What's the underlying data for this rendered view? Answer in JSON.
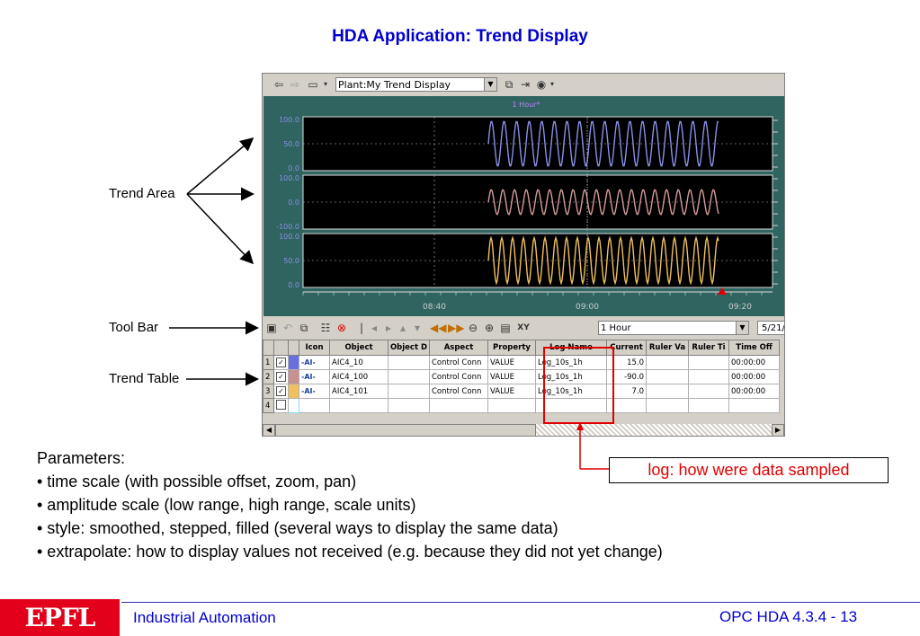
{
  "slide": {
    "title": "HDA Application: Trend Display",
    "callouts": {
      "trend_area": "Trend Area",
      "tool_bar": "Tool Bar",
      "trend_table": "Trend Table"
    },
    "params_heading": "Parameters:",
    "params": [
      "• time scale (with possible offset, zoom, pan)",
      "• amplitude scale (low range, high range, scale units)",
      "• style: smoothed, stepped, filled (several ways to display the same data)",
      "• extrapolate: how to display values not received (e.g. because they did not yet change)"
    ],
    "log_callout": "log: how were data sampled",
    "footer": {
      "logo": "EPFL",
      "course": "Industrial Automation",
      "page": "OPC HDA 4.3.4 - 13"
    }
  },
  "app": {
    "view_name": "Plant:My Trend Display",
    "toolbar_icons": [
      "back-icon",
      "forward-icon",
      "print-icon",
      "dropdown-icon",
      "layout-icon",
      "pin-icon",
      "eye-icon"
    ],
    "range_label": "1 Hour*",
    "y_axes": [
      [
        "100.0",
        "50.0",
        "0.0"
      ],
      [
        "100.0",
        "0.0",
        "-100.0"
      ],
      [
        "100.0",
        "50.0",
        "0.0"
      ]
    ],
    "x_ticks": [
      "08:40",
      "09:00",
      "09:20"
    ],
    "series_colors": [
      "#8a8fe6",
      "#d49a9a",
      "#f0c060"
    ],
    "time_range": "1 Hour",
    "date": "5/21/",
    "table": {
      "headers": [
        "",
        "",
        "Icon",
        "Object",
        "Object D",
        "Aspect",
        "Property",
        "Log Name",
        "Current",
        "Ruler Va",
        "Ruler Ti",
        "Time Off"
      ],
      "rows": [
        {
          "n": "1",
          "checked": true,
          "color": "#6a6fe0",
          "icon": "-AI-",
          "object": "AIC4_10",
          "aspect": "Control Conn",
          "property": "VALUE",
          "log": "Log_10s_1h",
          "current": "15.0",
          "time": "00:00:00"
        },
        {
          "n": "2",
          "checked": true,
          "color": "#c89090",
          "icon": "-AI-",
          "object": "AIC4_100",
          "aspect": "Control Conn",
          "property": "VALUE",
          "log": "Log_10s_1h",
          "current": "-90.0",
          "time": "00:00:00"
        },
        {
          "n": "3",
          "checked": true,
          "color": "#f0c060",
          "icon": "-AI-",
          "object": "AIC4_101",
          "aspect": "Control Conn",
          "property": "VALUE",
          "log": "Log_10s_1h",
          "current": "7.0",
          "time": "00:00:00"
        },
        {
          "n": "4",
          "checked": false,
          "color": "#7fe0ff",
          "icon": "",
          "object": "",
          "aspect": "",
          "property": "",
          "log": "",
          "current": "",
          "time": ""
        }
      ]
    }
  },
  "colors": {
    "title_blue": "#0000cc",
    "highlight_red": "#e00000",
    "epfl_red": "#e2001a",
    "panel_teal": "#2f6461"
  }
}
